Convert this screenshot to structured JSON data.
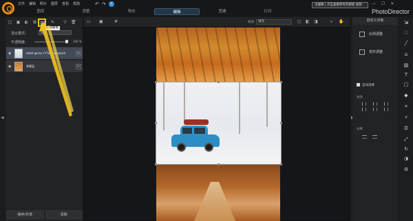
{
  "menu": {
    "file": "文件",
    "edit": "编辑",
    "photo": "照片",
    "layer": "图层",
    "view": "查看",
    "help": "帮助"
  },
  "tabs": [
    {
      "label": "图库"
    },
    {
      "label": "调整"
    },
    {
      "label": "导向"
    },
    {
      "label": "编辑"
    },
    {
      "label": "团建"
    },
    {
      "label": "打印"
    }
  ],
  "active_tab": "编辑",
  "notification": "迅捷教  |  点击查看所有的教程 视频",
  "brand": "PhotoDirector",
  "left_panel": {
    "tooltip": "添加蒙版",
    "blend_label": "混合模式:",
    "blend_value": "普通",
    "opacity_label": "不透明度:",
    "opacity_value": "100 %",
    "opacity_fraction": 1.0,
    "layers": [
      {
        "name": "rotell-gorse-7-Ftwo-unsplash"
      },
      {
        "name": "背景层"
      }
    ],
    "save_share": "保存/共享",
    "clear": "清除"
  },
  "main": {
    "zoom_label": "缩放:",
    "zoom_value": "填充"
  },
  "right_panel": {
    "title": "自定义对象",
    "scale_label": "比例调整",
    "transform_label": "变形调整",
    "auto_select_label": "自动选择",
    "align_label": "对齐",
    "distribute_label": "分布"
  },
  "icons": {
    "accent": "#f0c21a",
    "selected_layer": "#424a58",
    "active_tab": "#233748"
  }
}
